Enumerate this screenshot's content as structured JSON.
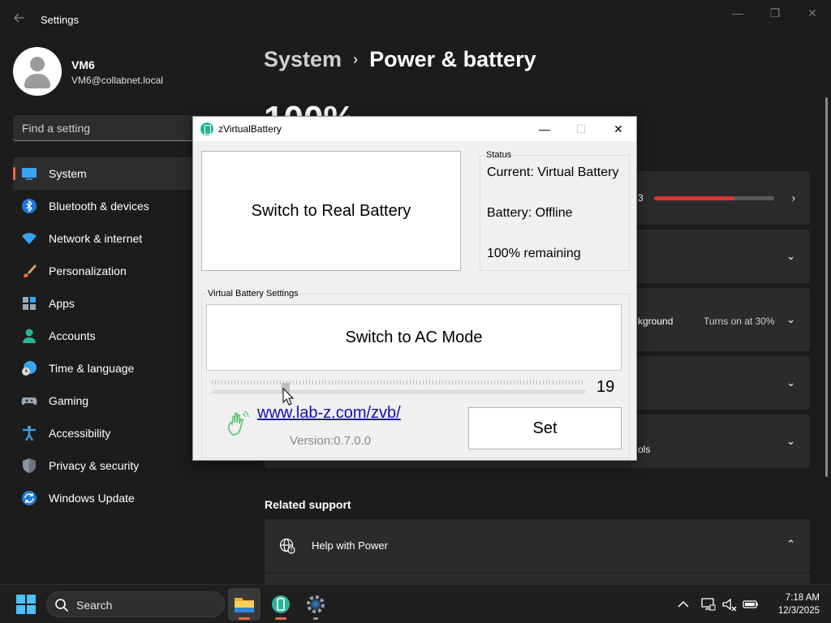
{
  "window": {
    "app_title": "Settings",
    "controls": {
      "minimize": "—",
      "restore": "❐",
      "close": "✕"
    }
  },
  "profile": {
    "name": "VM6",
    "email": "VM6@collabnet.local"
  },
  "search": {
    "placeholder": "Find a setting"
  },
  "nav": {
    "accent_color": "#e8654a",
    "items": [
      {
        "label": "System",
        "icon": "system-icon",
        "active": true
      },
      {
        "label": "Bluetooth & devices",
        "icon": "bluetooth-icon"
      },
      {
        "label": "Network & internet",
        "icon": "network-icon"
      },
      {
        "label": "Personalization",
        "icon": "brush-icon"
      },
      {
        "label": "Apps",
        "icon": "apps-icon"
      },
      {
        "label": "Accounts",
        "icon": "accounts-icon"
      },
      {
        "label": "Time & language",
        "icon": "time-language-icon"
      },
      {
        "label": "Gaming",
        "icon": "gaming-icon"
      },
      {
        "label": "Accessibility",
        "icon": "accessibility-icon"
      },
      {
        "label": "Privacy & security",
        "icon": "shield-icon"
      },
      {
        "label": "Windows Update",
        "icon": "windows-update-icon"
      }
    ]
  },
  "breadcrumb": {
    "parent": "System",
    "separator": "›",
    "current": "Power & battery"
  },
  "battery_summary": {
    "percent_text": "100%"
  },
  "cards": {
    "usage": {
      "text_fragment": "3",
      "level_percent": 66,
      "bar_color": "#e03535"
    },
    "saver": {
      "text_fragment": "kground",
      "status": "Turns on at 30%"
    },
    "controls": {
      "text_fragment": "ols"
    }
  },
  "related": {
    "title": "Related support",
    "help_label": "Help with Power"
  },
  "dialog": {
    "title": "zVirtualBattery",
    "controls": {
      "minimize": "—",
      "maximize": "☐",
      "close": "✕"
    },
    "switch_button": "Switch to Real Battery",
    "status": {
      "caption": "Status",
      "current": "Current: Virtual Battery",
      "battery": "Battery: Offline",
      "remaining": "100% remaining"
    },
    "settings": {
      "caption": "Virtual Battery Settings",
      "ac_button": "Switch to AC Mode",
      "slider_value": "19",
      "slider_min": 0,
      "slider_max": 100,
      "link": "www.lab-z.com/zvb/",
      "version": "Version:0.7.0.0",
      "set_button": "Set"
    }
  },
  "taskbar": {
    "search_label": "Search",
    "apps": [
      "file-explorer-icon",
      "zvirtualbattery-icon",
      "settings-gear-icon"
    ],
    "tray": [
      "chevron-up-icon",
      "network-icon",
      "volume-muted-icon",
      "battery-icon"
    ],
    "time": "7:18 AM",
    "date": "12/3/2025"
  }
}
